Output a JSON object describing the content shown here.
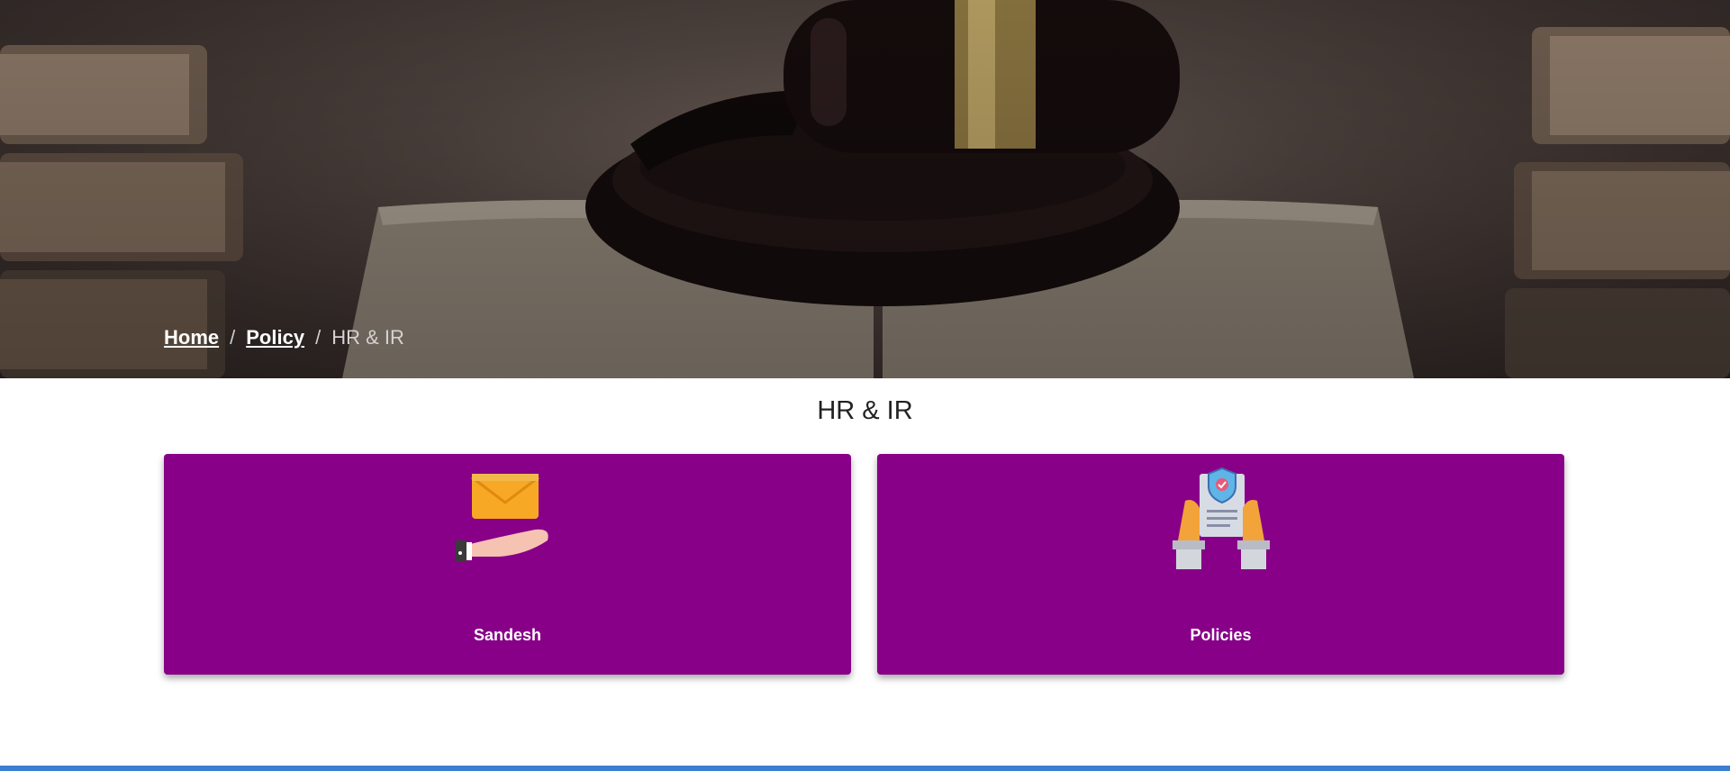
{
  "breadcrumb": {
    "items": [
      "Home",
      "Policy"
    ],
    "current": "HR & IR",
    "separator": "/"
  },
  "page": {
    "title": "HR & IR"
  },
  "cards": [
    {
      "label": "Sandesh",
      "icon": "envelope-hand-icon"
    },
    {
      "label": "Policies",
      "icon": "policy-document-icon"
    }
  ],
  "colors": {
    "card_background": "#880088",
    "bottom_bar": "#3a7fd1"
  }
}
